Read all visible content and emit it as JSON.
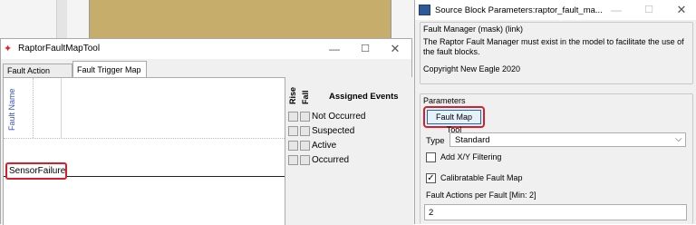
{
  "fault_map_tool": {
    "title": "RaptorFaultMapTool",
    "controls": {
      "minimize": "—",
      "maximize": "☐",
      "close": "✕"
    },
    "tabs": [
      {
        "label": "Fault Action Map",
        "active": false
      },
      {
        "label": "Fault Trigger Map",
        "active": true
      }
    ],
    "table": {
      "fault_name_header": "Fault Name",
      "rows": [
        "SensorFailure"
      ]
    },
    "events": {
      "rise_header": "Rise",
      "fall_header": "Fall",
      "assigned_header": "Assigned Events",
      "items": [
        {
          "label": "Not Occurred",
          "rise": false,
          "fall": false
        },
        {
          "label": "Suspected",
          "rise": false,
          "fall": false
        },
        {
          "label": "Active",
          "rise": false,
          "fall": false
        },
        {
          "label": "Occurred",
          "rise": false,
          "fall": false
        }
      ]
    }
  },
  "block_params": {
    "title": "Source Block Parameters:raptor_fault_ma...",
    "controls": {
      "minimize": "—",
      "maximize": "☐",
      "close": "✕"
    },
    "description": {
      "header": "Fault Manager (mask) (link)",
      "text": "The Raptor Fault Manager must exist in the model to facilitate the use of the fault blocks.",
      "copyright": "Copyright New Eagle 2020"
    },
    "parameters": {
      "header": "Parameters",
      "fault_map_tool_button": "Fault Map Tool",
      "type_label": "Type",
      "type_value": "Standard",
      "add_xy_filtering_label": "Add X/Y Filtering",
      "add_xy_filtering_checked": false,
      "calibratable_label": "Calibratable Fault Map",
      "calibratable_checked": true,
      "fault_actions_label": "Fault Actions per Fault [Min: 2]",
      "fault_actions_value": "2"
    }
  },
  "colors": {
    "highlight_red": "#d81e28",
    "model_block_tan": "#c6ad6c",
    "fault_name_header_blue": "#3b55c9",
    "button_focus_blue": "#0a6ecf"
  }
}
